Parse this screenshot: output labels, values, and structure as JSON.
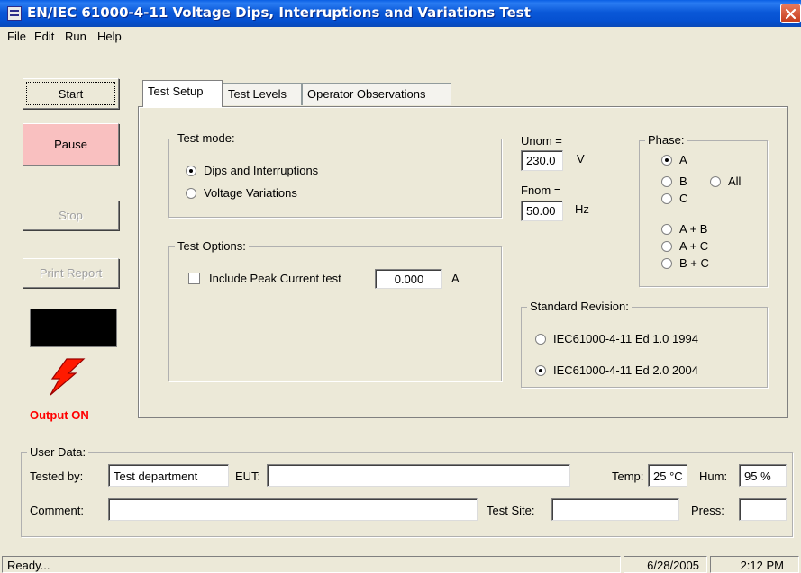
{
  "window": {
    "title": "EN/IEC 61000-4-11 Voltage Dips, Interruptions and Variations Test"
  },
  "menu": [
    {
      "label": "File"
    },
    {
      "label": "Edit"
    },
    {
      "label": "Run"
    },
    {
      "label": "Help"
    }
  ],
  "controls": {
    "start": "Start",
    "pause": "Pause",
    "stop": "Stop",
    "print_report": "Print Report",
    "output_status": "Output ON",
    "pause_color": "#f9c0c0",
    "output_status_color": "#ff0000"
  },
  "tabs": [
    {
      "label": "Test Setup",
      "active": true
    },
    {
      "label": "Test Levels",
      "active": false
    },
    {
      "label": "Operator Observations",
      "active": false
    }
  ],
  "test_mode": {
    "title": "Test mode:",
    "options": [
      {
        "label": "Dips and Interruptions",
        "selected": true
      },
      {
        "label": "Voltage Variations",
        "selected": false
      }
    ]
  },
  "test_options": {
    "title": "Test Options:",
    "peak_current_label": "Include Peak Current test",
    "peak_current_checked": false,
    "peak_current_value": "0.000",
    "peak_current_unit": "A"
  },
  "nominal": {
    "unom_label": "Unom =",
    "unom_value": "230.0",
    "unom_unit": "V",
    "fnom_label": "Fnom =",
    "fnom_value": "50.00",
    "fnom_unit": "Hz"
  },
  "phase": {
    "title": "Phase:",
    "options": [
      {
        "label": "A",
        "selected": true
      },
      {
        "label": "B",
        "selected": false
      },
      {
        "label": "All",
        "selected": false
      },
      {
        "label": "C",
        "selected": false
      },
      {
        "label": "A + B",
        "selected": false
      },
      {
        "label": "A + C",
        "selected": false
      },
      {
        "label": "B + C",
        "selected": false
      }
    ]
  },
  "standard_revision": {
    "title": "Standard Revision:",
    "options": [
      {
        "label": "IEC61000-4-11 Ed 1.0 1994",
        "selected": false
      },
      {
        "label": "IEC61000-4-11 Ed 2.0 2004",
        "selected": true
      }
    ]
  },
  "user_data": {
    "title": "User Data:",
    "tested_by_label": "Tested by:",
    "tested_by_value": "Test department",
    "eut_label": "EUT:",
    "eut_value": "",
    "temp_label": "Temp:",
    "temp_value": "25 °C",
    "hum_label": "Hum:",
    "hum_value": "95 %",
    "comment_label": "Comment:",
    "comment_value": "",
    "test_site_label": "Test Site:",
    "test_site_value": "",
    "press_label": "Press:",
    "press_value": ""
  },
  "status_bar": {
    "status": "Ready...",
    "date": "6/28/2005",
    "time": "2:12 PM"
  }
}
